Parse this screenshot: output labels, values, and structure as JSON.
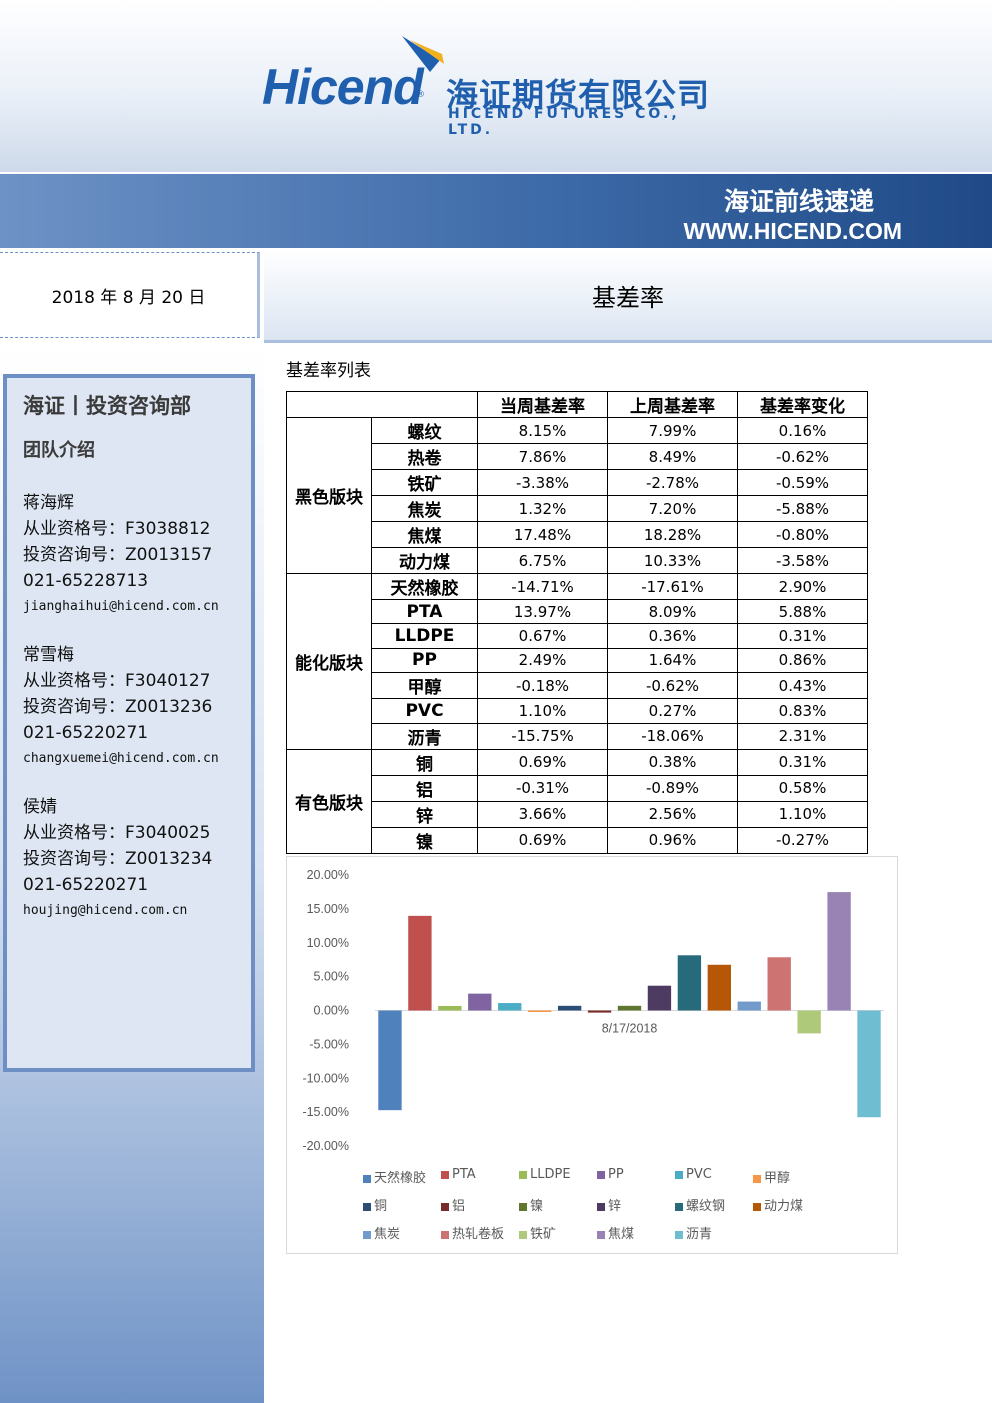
{
  "header": {
    "logo_en": "Hicend",
    "logo_reg": "®",
    "logo_cn": "海证期货有限公司",
    "logo_sub": "HICEND FUTURES CO., LTD.",
    "band_title": "海证前线速递",
    "band_url": "WWW.HICEND.COM"
  },
  "report": {
    "date": "2018 年 8 月 20 日",
    "title": "基差率"
  },
  "sidebar": {
    "dept": "海证丨投资咨询部",
    "team_intro": "团队介绍",
    "members": [
      {
        "name": "蒋海辉",
        "qual": "从业资格号：F3038812",
        "consult": "投资咨询号：Z0013157",
        "phone": "021-65228713",
        "email": "jianghaihui@hicend.com.cn"
      },
      {
        "name": "常雪梅",
        "qual": "从业资格号：F3040127",
        "consult": "投资咨询号：Z0013236",
        "phone": "021-65220271",
        "email": "changxuemei@hicend.com.cn"
      },
      {
        "name": "侯婧",
        "qual": "从业资格号：F3040025",
        "consult": "投资咨询号：Z0013234",
        "phone": "021-65220271",
        "email": "houjing@hicend.com.cn"
      }
    ]
  },
  "table": {
    "section_title": "基差率列表",
    "headers": [
      "当周基差率",
      "上周基差率",
      "基差率变化"
    ],
    "groups": [
      {
        "sector": "黑色版块",
        "rows": [
          [
            "螺纹",
            "8.15%",
            "7.99%",
            "0.16%"
          ],
          [
            "热卷",
            "7.86%",
            "8.49%",
            "-0.62%"
          ],
          [
            "铁矿",
            "-3.38%",
            "-2.78%",
            "-0.59%"
          ],
          [
            "焦炭",
            "1.32%",
            "7.20%",
            "-5.88%"
          ],
          [
            "焦煤",
            "17.48%",
            "18.28%",
            "-0.80%"
          ],
          [
            "动力煤",
            "6.75%",
            "10.33%",
            "-3.58%"
          ]
        ]
      },
      {
        "sector": "能化版块",
        "rows": [
          [
            "天然橡胶",
            "-14.71%",
            "-17.61%",
            "2.90%"
          ],
          [
            "PTA",
            "13.97%",
            "8.09%",
            "5.88%"
          ],
          [
            "LLDPE",
            "0.67%",
            "0.36%",
            "0.31%"
          ],
          [
            "PP",
            "2.49%",
            "1.64%",
            "0.86%"
          ],
          [
            "甲醇",
            "-0.18%",
            "-0.62%",
            "0.43%"
          ],
          [
            "PVC",
            "1.10%",
            "0.27%",
            "0.83%"
          ],
          [
            "沥青",
            "-15.75%",
            "-18.06%",
            "2.31%"
          ]
        ]
      },
      {
        "sector": "有色版块",
        "rows": [
          [
            "铜",
            "0.69%",
            "0.38%",
            "0.31%"
          ],
          [
            "铝",
            "-0.31%",
            "-0.89%",
            "0.58%"
          ],
          [
            "锌",
            "3.66%",
            "2.56%",
            "1.10%"
          ],
          [
            "镍",
            "0.69%",
            "0.96%",
            "-0.27%"
          ]
        ]
      }
    ]
  },
  "chart_data": {
    "type": "bar",
    "categories": [
      "8/17/2018"
    ],
    "ylim": [
      -20,
      20
    ],
    "yticks": [
      "20.00%",
      "15.00%",
      "10.00%",
      "5.00%",
      "0.00%",
      "-5.00%",
      "-10.00%",
      "-15.00%",
      "-20.00%"
    ],
    "series": [
      {
        "name": "天然橡胶",
        "values": [
          -14.71
        ],
        "color": "#4f81bd"
      },
      {
        "name": "PTA",
        "values": [
          13.97
        ],
        "color": "#c0504d"
      },
      {
        "name": "LLDPE",
        "values": [
          0.67
        ],
        "color": "#9bbb59"
      },
      {
        "name": "PP",
        "values": [
          2.49
        ],
        "color": "#8064a2"
      },
      {
        "name": "PVC",
        "values": [
          1.1
        ],
        "color": "#4bacc6"
      },
      {
        "name": "甲醇",
        "values": [
          -0.18
        ],
        "color": "#f79646"
      },
      {
        "name": "铜",
        "values": [
          0.69
        ],
        "color": "#2c4d75"
      },
      {
        "name": "铝",
        "values": [
          -0.31
        ],
        "color": "#772c2a"
      },
      {
        "name": "镍",
        "values": [
          0.69
        ],
        "color": "#5f7530"
      },
      {
        "name": "锌",
        "values": [
          3.66
        ],
        "color": "#4d3b62"
      },
      {
        "name": "螺纹钢",
        "values": [
          8.15
        ],
        "color": "#276a7c"
      },
      {
        "name": "动力煤",
        "values": [
          6.75
        ],
        "color": "#b65708"
      },
      {
        "name": "焦炭",
        "values": [
          1.32
        ],
        "color": "#729aca"
      },
      {
        "name": "热轧卷板",
        "values": [
          7.86
        ],
        "color": "#cd7371"
      },
      {
        "name": "铁矿",
        "values": [
          -3.38
        ],
        "color": "#afc97a"
      },
      {
        "name": "焦煤",
        "values": [
          17.48
        ],
        "color": "#9983b5"
      },
      {
        "name": "沥青",
        "values": [
          -15.75
        ],
        "color": "#6fbdd1"
      }
    ]
  }
}
